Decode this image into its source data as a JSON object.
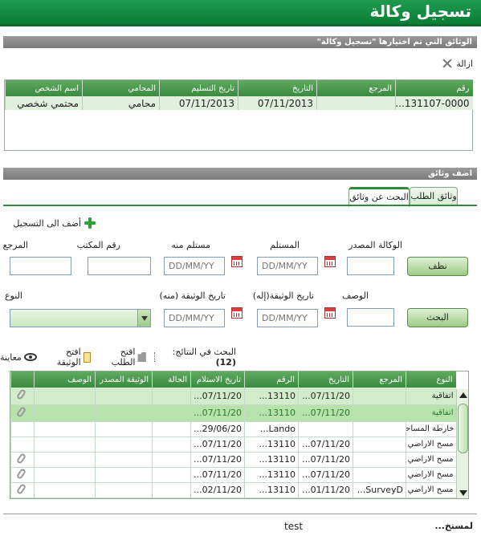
{
  "window": {
    "title": "تسجيل وكالة"
  },
  "selected_section": {
    "title": "الوثائق التي تم اختيارها  \"تسجيل وكالة\"",
    "remove_label": "ازالة"
  },
  "selected_table": {
    "columns": [
      "رقم",
      "المرجع",
      "التاريخ",
      "تاريخ التسليم",
      "المحامي",
      "اسم الشخص"
    ],
    "rows": [
      [
        "131107-0000...",
        "",
        "07/11/2013",
        "07/11/2013",
        "محامي",
        "محتمي شخصي"
      ]
    ]
  },
  "add_section": {
    "title": "اضف وثائق"
  },
  "tabs": [
    {
      "label": "وثائق الطلب",
      "active": false
    },
    {
      "label": "البحث عن وثائق",
      "active": true
    }
  ],
  "add_to_registration": "أضف الى التسجيل",
  "search_form": {
    "labels": {
      "source_agency": "الوكالة المصدر",
      "recipient": "المستلم",
      "received_from": "مستلم منه",
      "office_number": "رقم المكتب",
      "reference": "المرجع",
      "description": "الوصف",
      "doc_date_to": "تاريخ الوثيقة(إله)",
      "doc_date_from": "تاريخ الوثيقة (منه)",
      "type": "النوع"
    },
    "date_placeholder": "DD/MM/YY",
    "clear_button": "نظف",
    "search_button": "البحث"
  },
  "results_toolbar": {
    "results_label": "البحث في النتائج:",
    "results_count": "(12)",
    "open_request": "افتح الطلب",
    "open_document": "افتح الوثيقة",
    "preview": "معاينة"
  },
  "results_table": {
    "columns": [
      "النوع",
      "المرجع",
      "التاريخ",
      "الرقم",
      "تاريخ الاستلام",
      "الحالة",
      "الوثيقة المصدر",
      "الوصف",
      ""
    ],
    "rows": [
      {
        "type": "اتفاقية",
        "ref": "",
        "date": "07/11/20...",
        "num": "13110...",
        "received": "07/11/20...",
        "status": "",
        "source": "",
        "desc": "",
        "attach": true
      },
      {
        "type": "اتفاقية",
        "ref": "",
        "date": "07/11/20...",
        "num": "13110...",
        "received": "07/11/20...",
        "status": "",
        "source": "",
        "desc": "",
        "attach": true
      },
      {
        "type": "خارطة المساحة",
        "ref": "",
        "date": "",
        "num": "Lando...",
        "received": "29/06/20...",
        "status": "",
        "source": "",
        "desc": "",
        "attach": false
      },
      {
        "type": "مسح الاراضي",
        "ref": "",
        "date": "07/11/20...",
        "num": "13110...",
        "received": "07/11/20...",
        "status": "",
        "source": "",
        "desc": "",
        "attach": false
      },
      {
        "type": "مسح الاراضي",
        "ref": "",
        "date": "07/11/20...",
        "num": "13110...",
        "received": "07/11/20...",
        "status": "",
        "source": "",
        "desc": "",
        "attach": true
      },
      {
        "type": "مسح الاراضي",
        "ref": "",
        "date": "07/11/20...",
        "num": "13110...",
        "received": "07/11/20...",
        "status": "",
        "source": "",
        "desc": "",
        "attach": true
      },
      {
        "type": "مسح الاراضي",
        "ref": "SurveyD...",
        "date": "01/11/20...",
        "num": "13110...",
        "received": "02/11/20...",
        "status": "",
        "source": "",
        "desc": "",
        "attach": true
      }
    ]
  },
  "footer": {
    "recipient_label": "لمستخ...",
    "value": "test"
  }
}
